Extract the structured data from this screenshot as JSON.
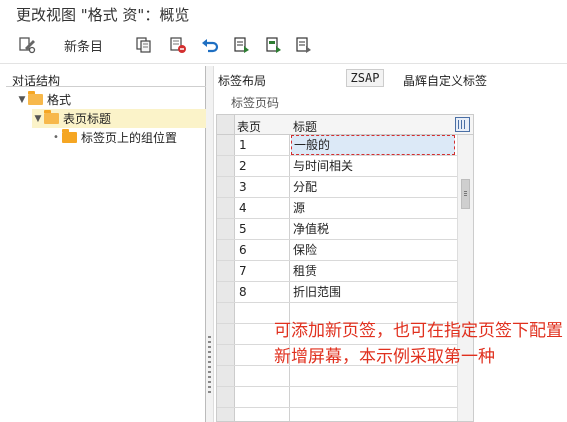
{
  "window": {
    "title": "更改视图 \"格式 资\"：概览"
  },
  "toolbar": {
    "new_entries_label": "新条目"
  },
  "left": {
    "header": "对话结构",
    "tree": [
      {
        "label": "格式"
      },
      {
        "label": "表页标题"
      },
      {
        "label": "标签页上的组位置"
      }
    ]
  },
  "right": {
    "layout_label": "标签布局",
    "layout_value": "ZSAP",
    "layout_desc": "晶辉自定义标签",
    "pagecode_label": "标签页码",
    "columns": {
      "page": "表页",
      "title": "标题"
    },
    "rows": [
      {
        "page": "1",
        "title": "一般的"
      },
      {
        "page": "2",
        "title": "与时间相关"
      },
      {
        "page": "3",
        "title": "分配"
      },
      {
        "page": "4",
        "title": "源"
      },
      {
        "page": "5",
        "title": "净值税"
      },
      {
        "page": "6",
        "title": "保险"
      },
      {
        "page": "7",
        "title": "租赁"
      },
      {
        "page": "8",
        "title": "折旧范围"
      }
    ]
  },
  "annotation": {
    "text": "可添加新页签，也可在指定页签下配置新增屏幕，本示例采取第一种"
  },
  "colors": {
    "annotation": "#e0301e",
    "selected_tree_row": "#fbf3c9",
    "folder": "#f5a623"
  }
}
